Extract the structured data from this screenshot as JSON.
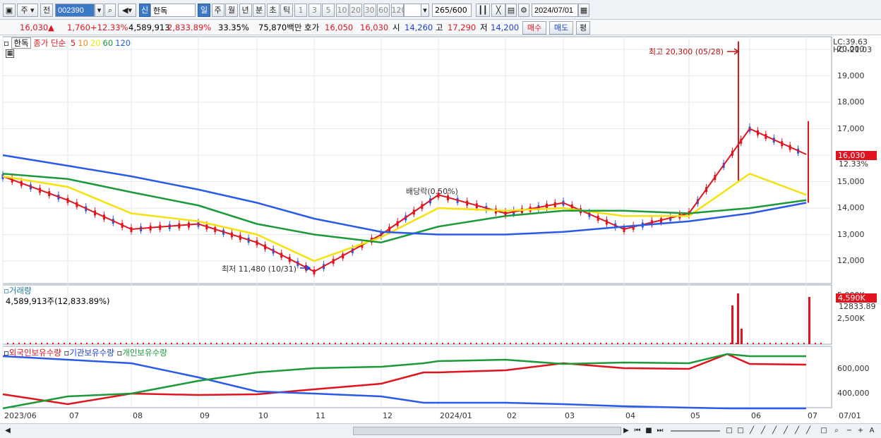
{
  "toolbar": {
    "period_label": "주",
    "prev_label": "전",
    "code_value": "002390",
    "market_badge": "신",
    "name_value": "한독",
    "period_buttons": [
      "일",
      "주",
      "월",
      "년",
      "분",
      "초",
      "틱"
    ],
    "interval_buttons": [
      "1",
      "3",
      "5",
      "10",
      "20",
      "30",
      "60",
      "120"
    ],
    "count_value": "265",
    "count_max": "/600",
    "date_value": "2024/07/01"
  },
  "info": {
    "price": "16,030",
    "change_arrow": "▲",
    "change": "1,760",
    "change_pct": "+12.33%",
    "volume": "4,589,913",
    "volume_pct": "2,833.89%",
    "turnover_pct": "33.35%",
    "amount": "75,870백만",
    "ask_label": "호가",
    "ask": "16,050",
    "bid": "16,030",
    "open_label": "시",
    "open": "14,260",
    "high_label": "고",
    "high": "17,290",
    "low_label": "저",
    "low": "14,200",
    "buy_label": "매수",
    "sell_label": "매도",
    "flat_label": "평"
  },
  "price_panel": {
    "stock_tag": "한독",
    "ma_title": "종가 단순",
    "ma_periods": [
      "5",
      "10",
      "20",
      "60",
      "120"
    ],
    "ma_colors": [
      "#e0141e",
      "#f08c10",
      "#f5e20a",
      "#1c9a3a",
      "#2a5ae8"
    ],
    "high_annotation": "최고 20,300 (05/28)",
    "low_annotation": "최저 11,480 (10/31)",
    "dividend_annotation": "배당락(0.50%)",
    "lc_label": "LC:39.63",
    "hc_label": "HC:-21.03",
    "current_price_tag": "16,030",
    "current_pct_tag": "12.33%",
    "y_ticks": [
      "20,000",
      "19,000",
      "18,000",
      "17,000",
      "16,000",
      "15,000",
      "14,000",
      "13,000",
      "12,000"
    ]
  },
  "volume_panel": {
    "title": "거래량",
    "value_text": "4,589,913주(12,833.89%)",
    "tag": "4,590K",
    "tag_pct": "12833.89",
    "y_ticks": [
      "5,000K",
      "2,500K"
    ]
  },
  "holding_panel": {
    "legend": [
      "외국인보유수량",
      "기관보유수량",
      "개인보유수량"
    ],
    "y_ticks": [
      "600,000",
      "400,000"
    ]
  },
  "x_axis": [
    "2023/06",
    "07",
    "08",
    "09",
    "10",
    "11",
    "12",
    "2024/01",
    "02",
    "03",
    "04",
    "05",
    "06",
    "07",
    "07/01"
  ],
  "chart_data": {
    "type": "line",
    "title": "",
    "x": [
      "2023/06",
      "07",
      "08",
      "09",
      "10",
      "11",
      "12",
      "2024/01",
      "02",
      "03",
      "04",
      "05",
      "06",
      "07"
    ],
    "ylim": [
      11200,
      20400
    ],
    "series": [
      {
        "name": "5",
        "values": [
          15200,
          14300,
          13200,
          13400,
          12700,
          11600,
          13000,
          14500,
          13800,
          14200,
          13200,
          13800,
          17000,
          16030
        ]
      },
      {
        "name": "20",
        "values": [
          15200,
          14800,
          13800,
          13500,
          13000,
          12000,
          12900,
          14000,
          13900,
          14000,
          13700,
          13700,
          15300,
          14500
        ]
      },
      {
        "name": "60",
        "values": [
          15300,
          15100,
          14600,
          14100,
          13400,
          13000,
          12700,
          13300,
          13700,
          13900,
          13900,
          13800,
          14000,
          14300
        ]
      },
      {
        "name": "120",
        "values": [
          16000,
          15600,
          15200,
          14700,
          14200,
          13600,
          13100,
          13000,
          13000,
          13100,
          13300,
          13500,
          13800,
          14200
        ]
      }
    ],
    "high": 20300,
    "low": 11480,
    "current": 16030
  }
}
